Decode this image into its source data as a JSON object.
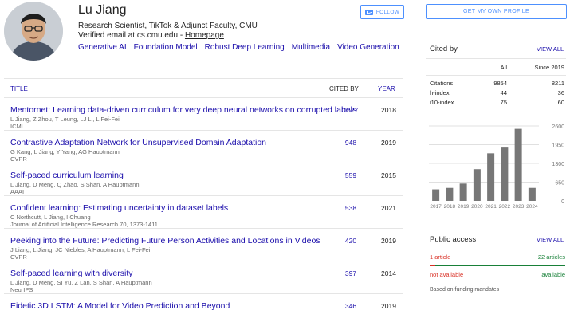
{
  "profile": {
    "name": "Lu Jiang",
    "affiliation_prefix": "Research Scientist, TikTok & Adjunct Faculty, ",
    "affiliation_link": "CMU",
    "email_prefix": "Verified email at cs.cmu.edu - ",
    "homepage_label": "Homepage",
    "interests": [
      "Generative AI",
      "Foundation Model",
      "Robust Deep Learning",
      "Multimedia",
      "Video Generation"
    ],
    "follow_label": "FOLLOW"
  },
  "table": {
    "header": {
      "title": "TITLE",
      "cited_by": "CITED BY",
      "year": "YEAR"
    },
    "rows": [
      {
        "title": "Mentornet: Learning data-driven curriculum for very deep neural networks on corrupted labels",
        "authors": "L Jiang, Z Zhou, T Leung, LJ Li, L Fei-Fei",
        "venue": "ICML",
        "cites": "1527",
        "year": "2018"
      },
      {
        "title": "Contrastive Adaptation Network for Unsupervised Domain Adaptation",
        "authors": "G Kang, L Jiang, Y Yang, AG Hauptmann",
        "venue": "CVPR",
        "cites": "948",
        "year": "2019"
      },
      {
        "title": "Self-paced curriculum learning",
        "authors": "L Jiang, D Meng, Q Zhao, S Shan, A Hauptmann",
        "venue": "AAAI",
        "cites": "559",
        "year": "2015"
      },
      {
        "title": "Confident learning: Estimating uncertainty in dataset labels",
        "authors": "C Northcutt, L Jiang, I Chuang",
        "venue": "Journal of Artificial Intelligence Research 70, 1373-1411",
        "cites": "538",
        "year": "2021"
      },
      {
        "title": "Peeking into the Future: Predicting Future Person Activities and Locations in Videos",
        "authors": "J Liang, L Jiang, JC Niebles, A Hauptmann, L Fei-Fei",
        "venue": "CVPR",
        "cites": "420",
        "year": "2019"
      },
      {
        "title": "Self-paced learning with diversity",
        "authors": "L Jiang, D Meng, SI Yu, Z Lan, S Shan, A Hauptmann",
        "venue": "NeurIPS",
        "cites": "397",
        "year": "2014"
      },
      {
        "title": "Eidetic 3D LSTM: A Model for Video Prediction and Beyond",
        "authors": "",
        "venue": "",
        "cites": "346",
        "year": "2019"
      }
    ]
  },
  "sidebar": {
    "my_profile_label": "GET MY OWN PROFILE",
    "cited_by": {
      "title": "Cited by",
      "view_all": "VIEW ALL",
      "col_all": "All",
      "col_since": "Since 2019",
      "stats": [
        {
          "label": "Citations",
          "all": "9854",
          "since": "8211"
        },
        {
          "label": "h-index",
          "all": "44",
          "since": "36"
        },
        {
          "label": "i10-index",
          "all": "75",
          "since": "60"
        }
      ]
    },
    "public_access": {
      "title": "Public access",
      "view_all": "VIEW ALL",
      "not_available_count": "1 article",
      "available_count": "22 articles",
      "not_available_label": "not available",
      "available_label": "available",
      "available_fraction": 0.957,
      "footnote": "Based on funding mandates"
    }
  },
  "chart_data": {
    "type": "bar",
    "categories": [
      "2017",
      "2018",
      "2019",
      "2020",
      "2021",
      "2022",
      "2023",
      "2024"
    ],
    "values": [
      400,
      450,
      600,
      1100,
      1650,
      1850,
      2500,
      450
    ],
    "yticks": [
      "0",
      "650",
      "1300",
      "1950",
      "2600"
    ],
    "ylim": [
      0,
      2600
    ],
    "grid": true,
    "colors": {
      "bar": "#777777",
      "grid": "#e0e0e0",
      "axis_text": "#777777"
    }
  },
  "colors": {
    "link": "#1a0dab",
    "accent": "#4d90fe",
    "green": "#188038",
    "red": "#d93025"
  }
}
